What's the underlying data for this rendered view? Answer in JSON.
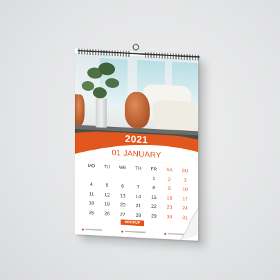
{
  "scene": {
    "background": "#e6e7e8",
    "subject": "wall-calendar-mockup"
  },
  "calendar": {
    "year": "2021",
    "month": "01 JANUARY",
    "accent_color": "#e2571d",
    "day_headers": [
      "MO",
      "TU",
      "WE",
      "TH",
      "FR",
      "SA",
      "SU"
    ],
    "weeks": [
      [
        "",
        "",
        "",
        "",
        "1",
        "2",
        "3"
      ],
      [
        "4",
        "5",
        "6",
        "7",
        "8",
        "9",
        "10"
      ],
      [
        "11",
        "12",
        "13",
        "14",
        "15",
        "16",
        "17"
      ],
      [
        "18",
        "19",
        "20",
        "21",
        "22",
        "23",
        "24"
      ],
      [
        "25",
        "26",
        "27",
        "28",
        "29",
        "30",
        "31"
      ]
    ],
    "tag": "MOCKUP"
  }
}
